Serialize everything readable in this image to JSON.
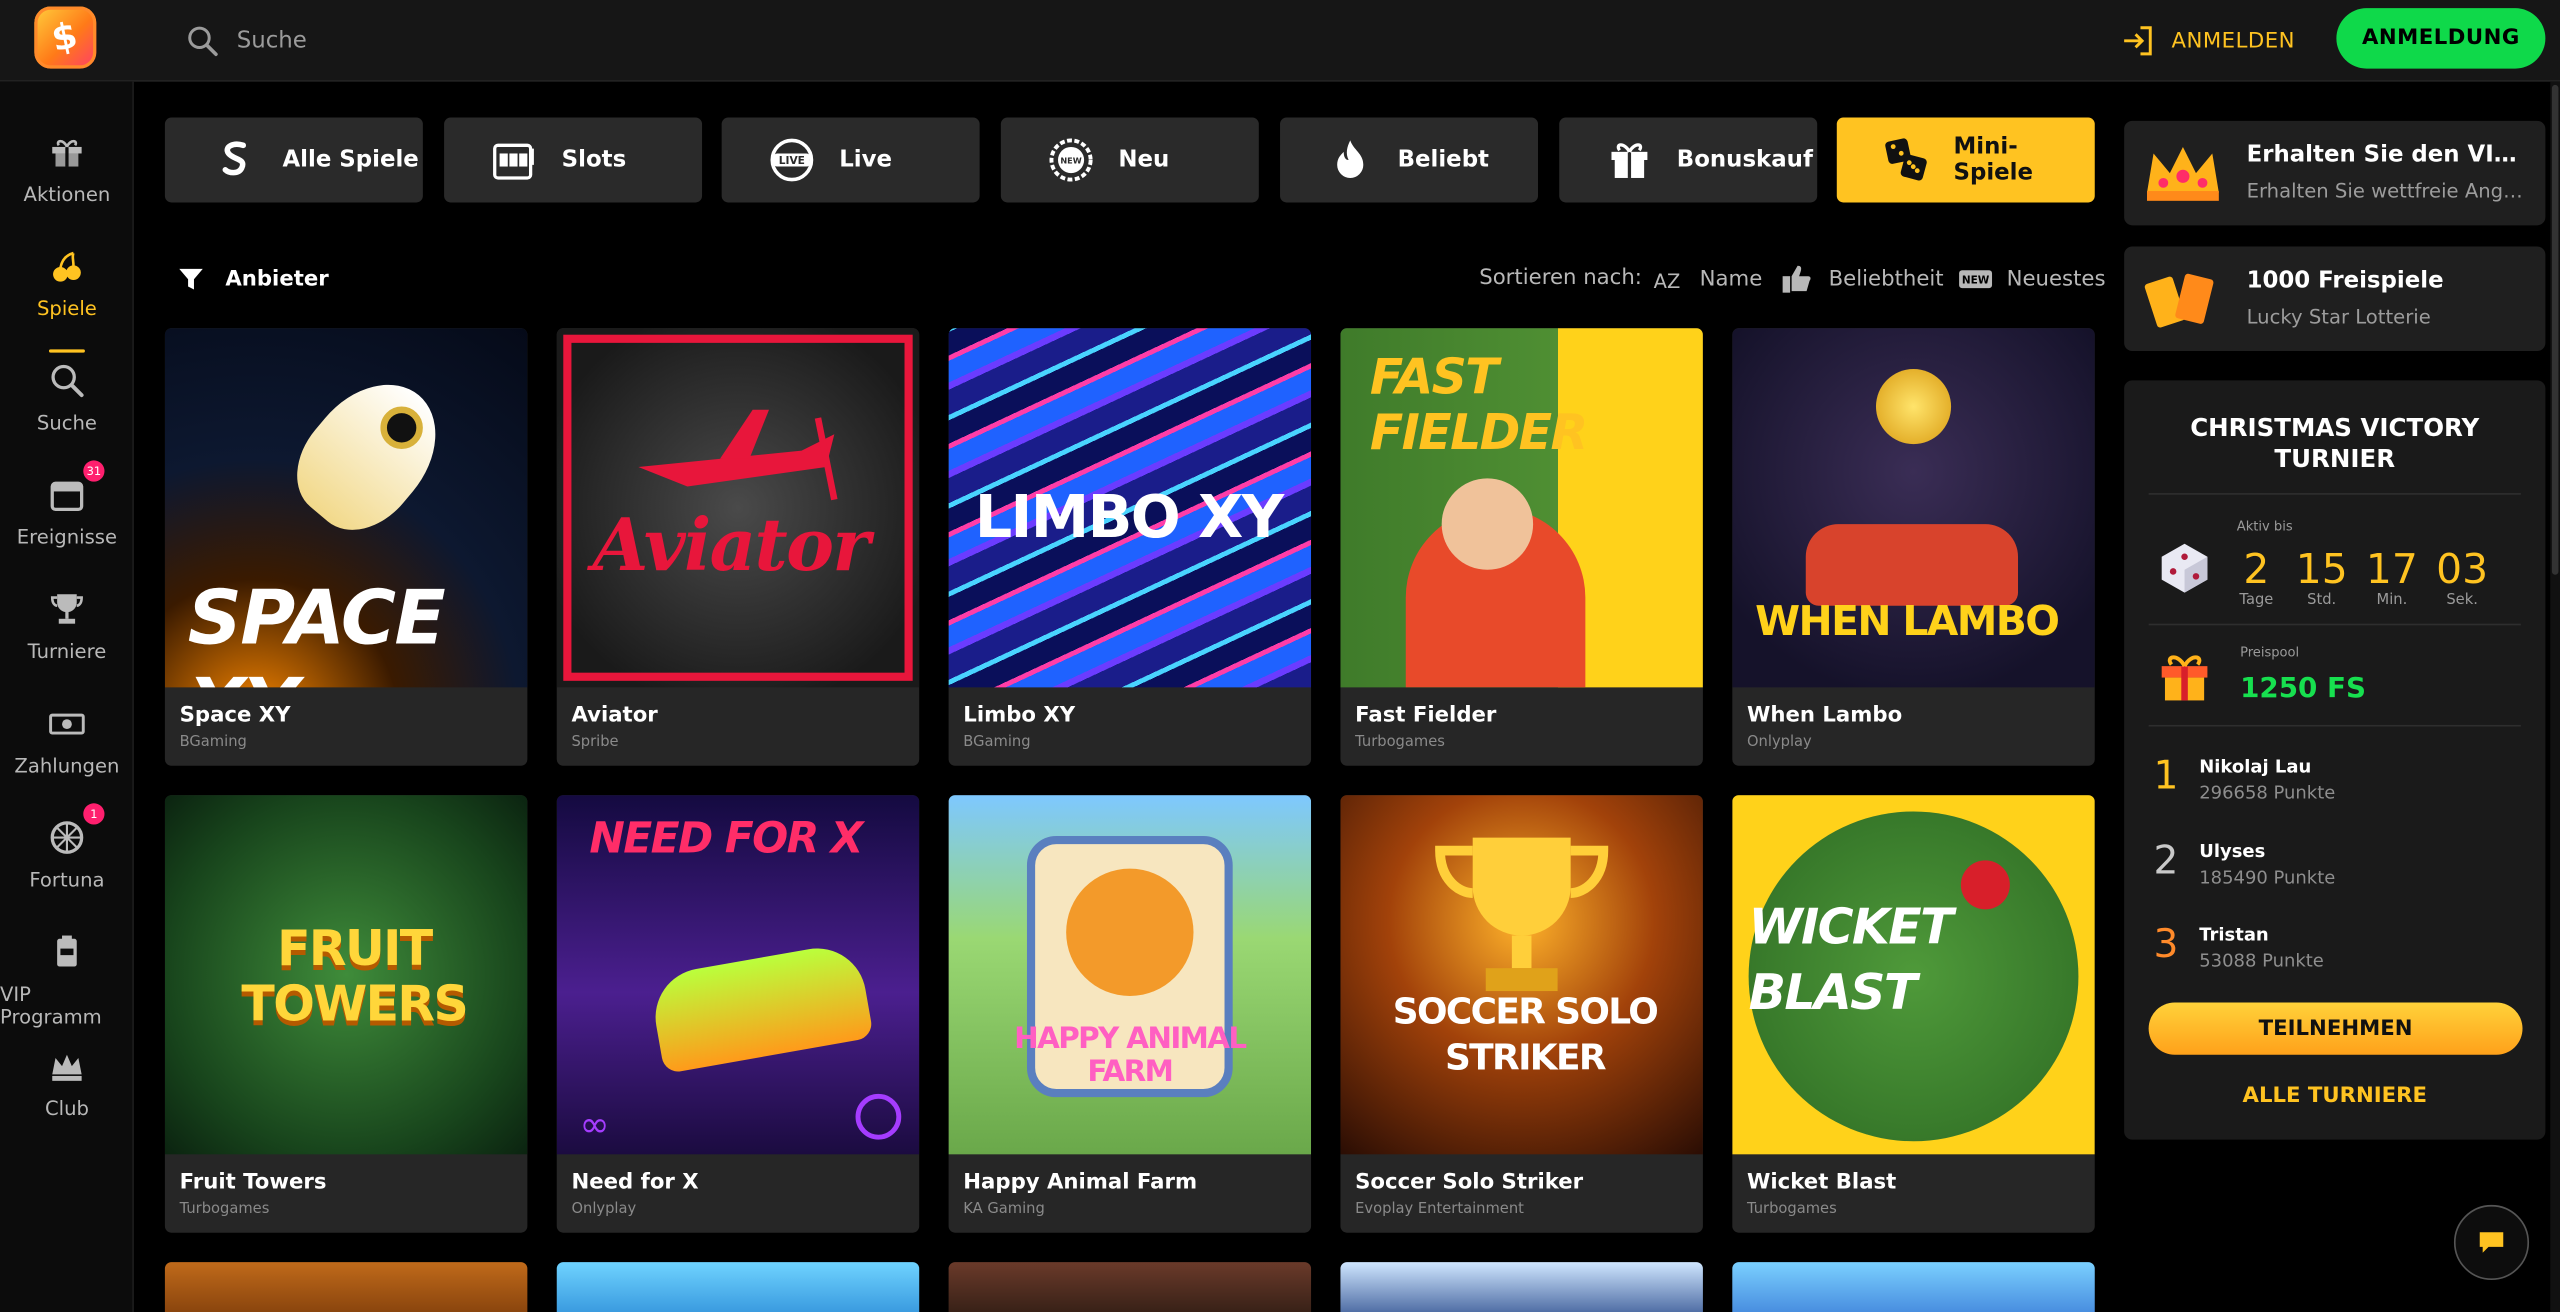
{
  "header": {
    "logo_text": "$",
    "search_placeholder": "Suche",
    "login_label": "ANMELDEN",
    "register_label": "ANMELDUNG"
  },
  "sidebar": {
    "items": [
      {
        "label": "Aktionen",
        "icon": "gift-icon"
      },
      {
        "label": "Spiele",
        "icon": "cherries-icon",
        "active": true
      },
      {
        "label": "Suche",
        "icon": "search-icon"
      },
      {
        "label": "Ereignisse",
        "icon": "calendar-icon",
        "badge": "31"
      },
      {
        "label": "Turniere",
        "icon": "trophy-icon"
      },
      {
        "label": "Zahlungen",
        "icon": "cash-icon"
      },
      {
        "label": "Fortuna",
        "icon": "wheel-icon",
        "badge": "1"
      },
      {
        "label": "VIP Programm",
        "icon": "vip-card-icon"
      },
      {
        "label": "Club",
        "icon": "crown-icon"
      }
    ]
  },
  "categories": [
    {
      "label": "Alle Spiele",
      "icon": "all-games-icon"
    },
    {
      "label": "Slots",
      "icon": "slot-machine-icon"
    },
    {
      "label": "Live",
      "icon": "live-icon"
    },
    {
      "label": "Neu",
      "icon": "new-badge-icon"
    },
    {
      "label": "Beliebt",
      "icon": "fire-icon"
    },
    {
      "label": "Bonuskauf",
      "icon": "gift-box-icon"
    },
    {
      "label": "Mini-Spiele",
      "icon": "dice-icon",
      "active": true
    }
  ],
  "filters": {
    "provider_label": "Anbieter",
    "sort_label": "Sortieren nach:",
    "sort_options": [
      "Name",
      "Beliebtheit",
      "Neuestes"
    ],
    "sort_name_glyph": "AZ",
    "sort_new_glyph": "NEW"
  },
  "games": [
    {
      "name": "Space XY",
      "provider": "BGaming",
      "art": "SPACE XY"
    },
    {
      "name": "Aviator",
      "provider": "Spribe",
      "art": "Aviator"
    },
    {
      "name": "Limbo XY",
      "provider": "BGaming",
      "art": "LIMBO XY"
    },
    {
      "name": "Fast Fielder",
      "provider": "Turbogames",
      "art": "FAST FIELDER"
    },
    {
      "name": "When Lambo",
      "provider": "Onlyplay",
      "art": "WHEN LAMBO"
    },
    {
      "name": "Fruit Towers",
      "provider": "Turbogames",
      "art": "FRUIT TOWERS"
    },
    {
      "name": "Need for X",
      "provider": "Onlyplay",
      "art": "NEED FOR X"
    },
    {
      "name": "Happy Animal Farm",
      "provider": "KA Gaming",
      "art": "HAPPY ANIMAL FARM"
    },
    {
      "name": "Soccer Solo Striker",
      "provider": "Evoplay Entertainment",
      "art": "SOCCER SOLO STRIKER"
    },
    {
      "name": "Wicket Blast",
      "provider": "Turbogames",
      "art": "WICKET BLAST"
    }
  ],
  "promos": [
    {
      "title": "Erhalten Sie den VIP-Status",
      "subtitle": "Erhalten Sie wettfreie Angebote",
      "icon": "crown-icon"
    },
    {
      "title": "1000 Freispiele",
      "subtitle": "Lucky Star Lotterie",
      "icon": "lottery-ticket-icon"
    }
  ],
  "tournament": {
    "title": "CHRISTMAS VICTORY TURNIER",
    "active_until_label": "Aktiv bis",
    "countdown": [
      {
        "value": "2",
        "unit": "Tage"
      },
      {
        "value": "15",
        "unit": "Std."
      },
      {
        "value": "17",
        "unit": "Min."
      },
      {
        "value": "03",
        "unit": "Sek."
      }
    ],
    "prize_pool_label": "Preispool",
    "prize_pool_value": "1250 FS",
    "leaders": [
      {
        "rank": "1",
        "name": "Nikolaj Lau",
        "points": "296658 Punkte",
        "color": "#ffc321"
      },
      {
        "rank": "2",
        "name": "Ulyses",
        "points": "185490 Punkte",
        "color": "#c9c9c9"
      },
      {
        "rank": "3",
        "name": "Tristan",
        "points": "53088 Punkte",
        "color": "#ff8a2a"
      }
    ],
    "join_label": "TEILNEHMEN",
    "all_label": "ALLE TURNIERE"
  },
  "colors": {
    "accent": "#ffc321",
    "register": "#0fd94a",
    "badge": "#ff1f6e",
    "pool": "#17e04f"
  }
}
